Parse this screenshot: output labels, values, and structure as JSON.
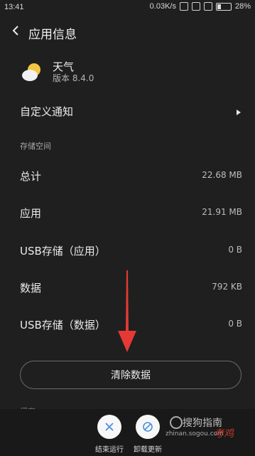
{
  "status_bar": {
    "time": "13:41",
    "network_speed": "0.03K/s",
    "battery": "28%"
  },
  "header": {
    "title": "应用信息"
  },
  "app": {
    "name": "天气",
    "version": "版本 8.4.0"
  },
  "custom_notification": {
    "label": "自定义通知"
  },
  "storage": {
    "section_label": "存储空间",
    "rows": [
      {
        "label": "总计",
        "value": "22.68 MB"
      },
      {
        "label": "应用",
        "value": "21.91 MB"
      },
      {
        "label": "USB存储（应用）",
        "value": "0 B"
      },
      {
        "label": "数据",
        "value": "792 KB"
      },
      {
        "label": "USB存储（数据）",
        "value": "0 B"
      }
    ]
  },
  "actions": {
    "clear_data": "清除数据",
    "partial_next": "缓存",
    "force_stop": "结束运行",
    "uninstall_updates": "卸载更新"
  },
  "watermark": {
    "name": "搜狗指南",
    "url": "zhinan.sogou.com",
    "tag": "考鸡"
  },
  "colors": {
    "background": "#1f1f1f",
    "arrow": "#e53935",
    "button_circle": "#f7f7f7"
  }
}
